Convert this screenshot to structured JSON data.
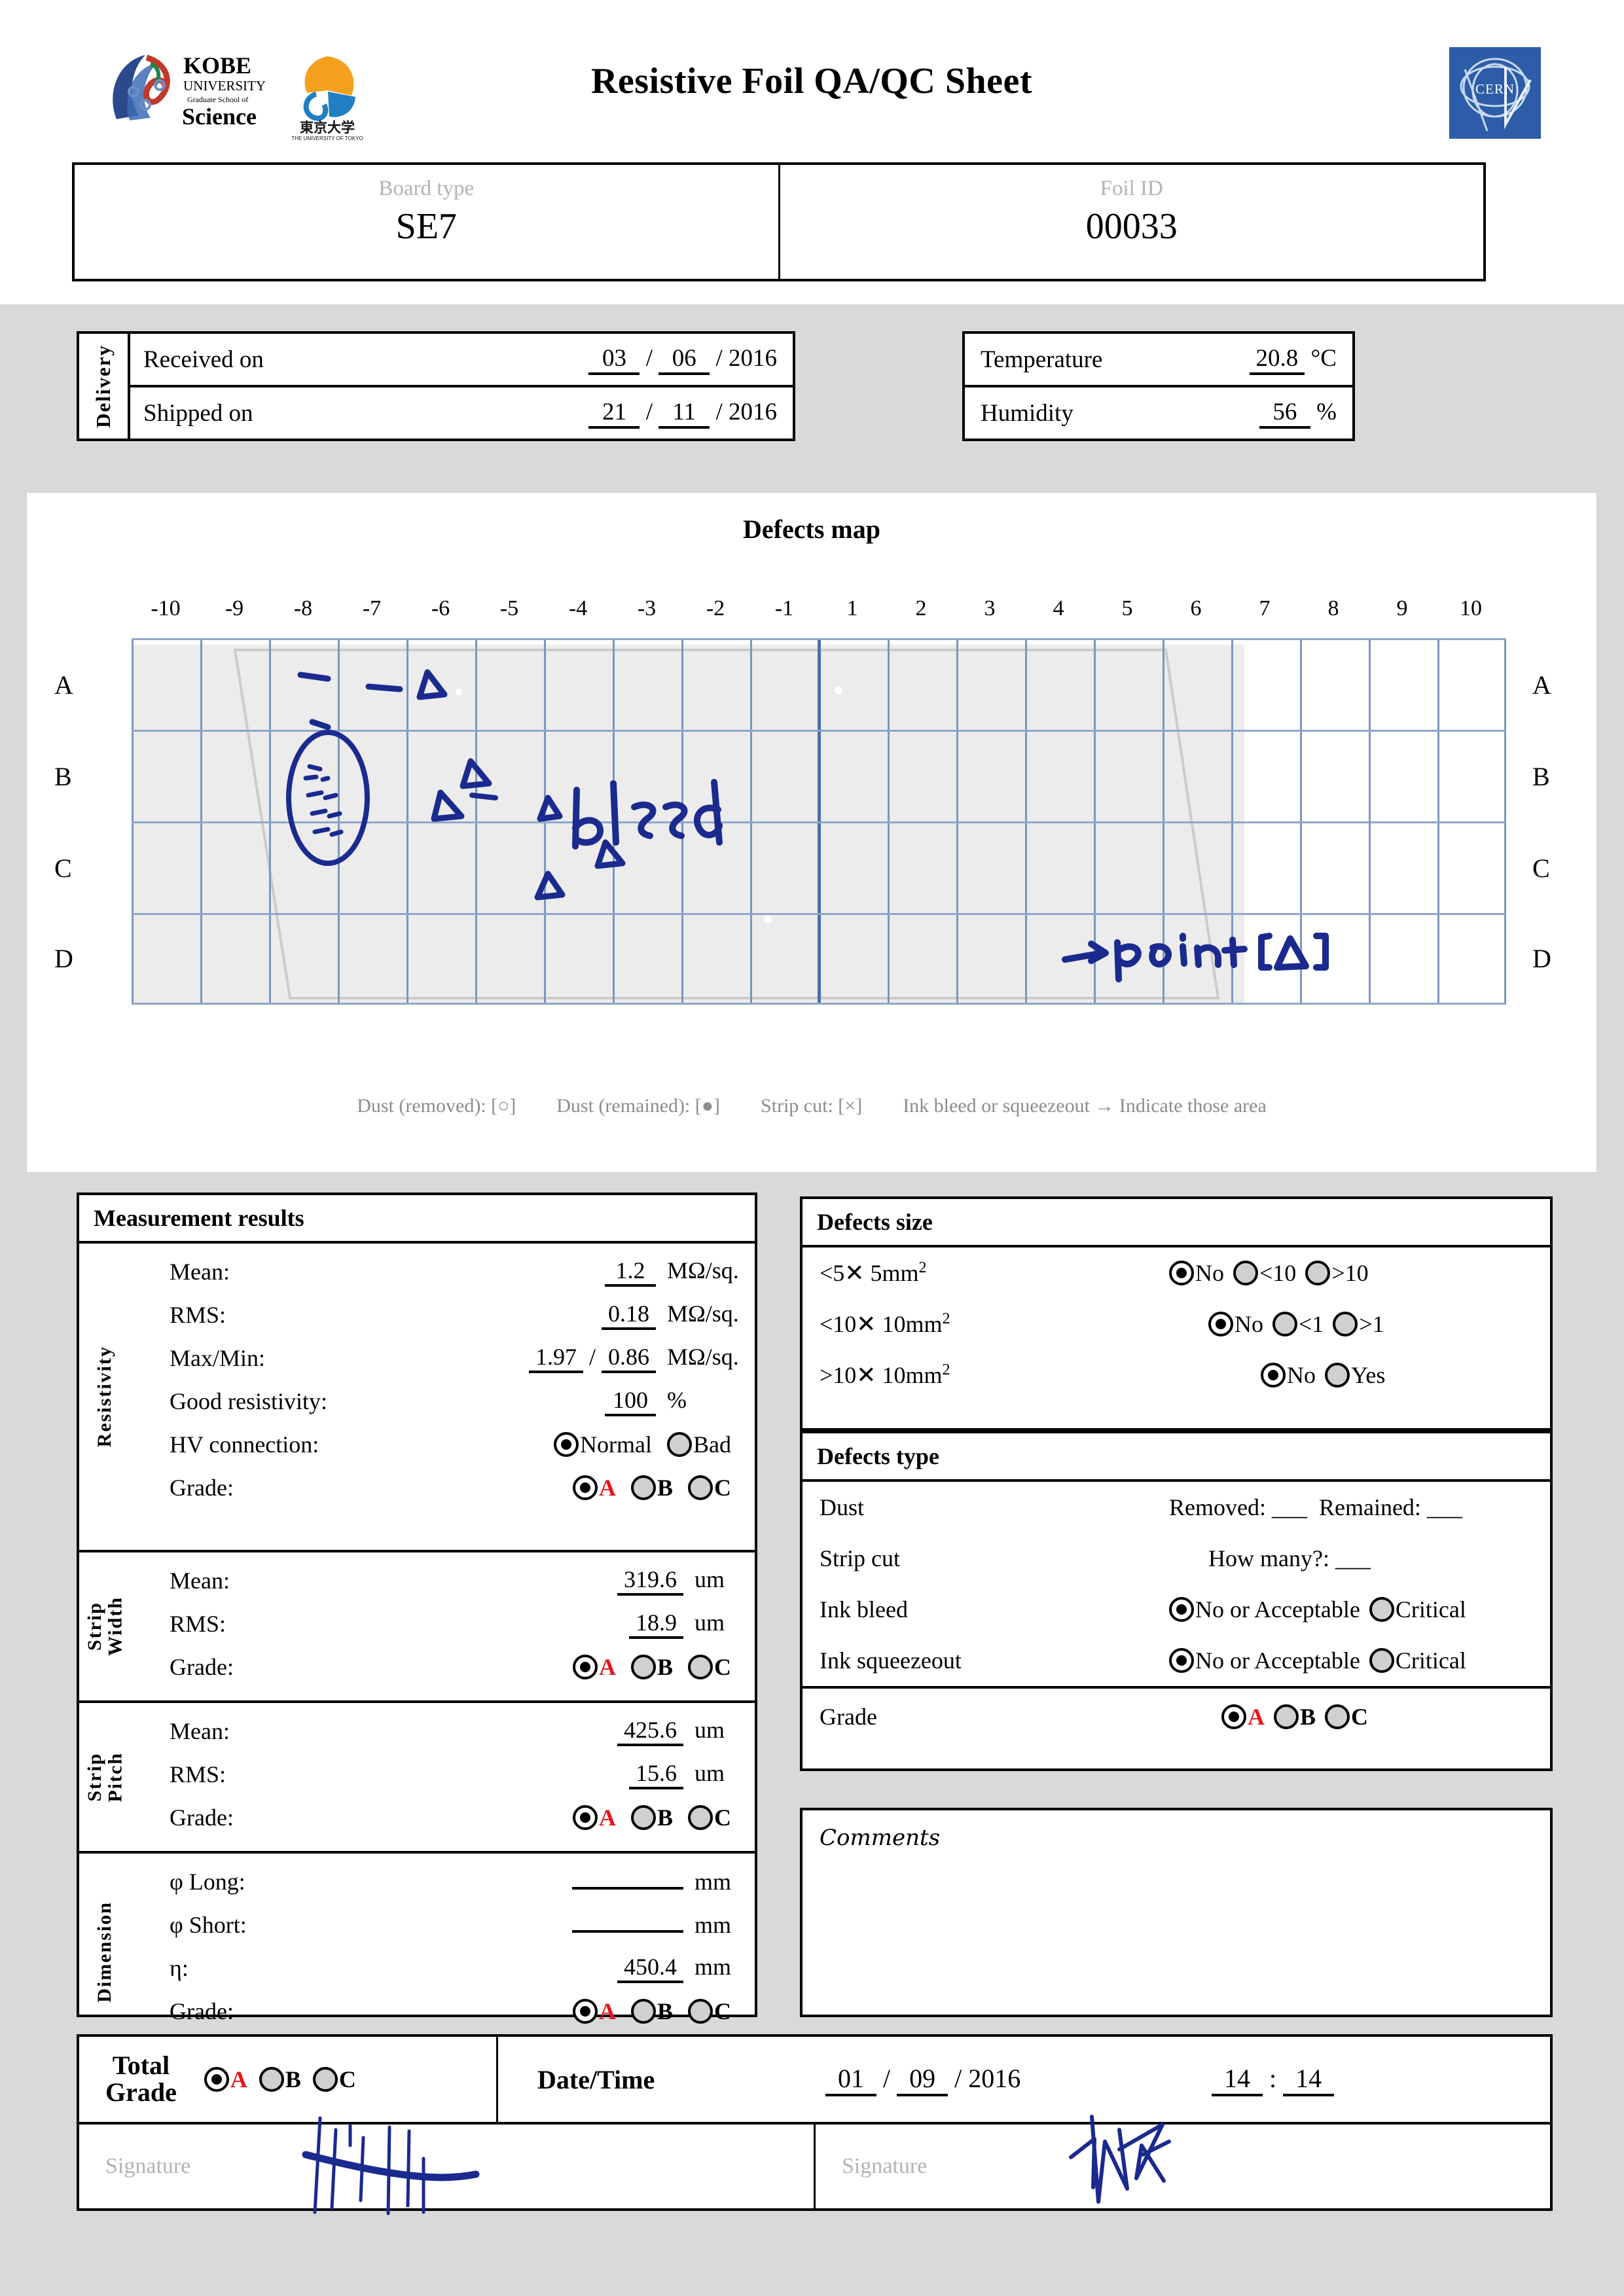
{
  "header": {
    "title": "Resistive Foil QA/QC Sheet",
    "logo_kobe_line1": "KOBE",
    "logo_kobe_line2": "UNIVERSITY",
    "logo_kobe_line3": "Graduate School of",
    "logo_kobe_line4": "Science",
    "logo_todai": "東京大学",
    "logo_todai_sub": "THE UNIVERSITY OF TOKYO",
    "logo_cern": "CERN",
    "board_type_caption": "Board type",
    "board_type_value": "SE7",
    "foil_id_caption": "Foil ID",
    "foil_id_value": "00033"
  },
  "delivery": {
    "section_label": "Delivery",
    "received_label": "Received on",
    "received_day": "03",
    "received_month": "06",
    "received_year": "2016",
    "shipped_label": "Shipped on",
    "shipped_day": "21",
    "shipped_month": "11",
    "shipped_year": "2016",
    "sep": "/"
  },
  "environment": {
    "temperature_label": "Temperature",
    "temperature_value": "20.8",
    "temperature_unit": "°C",
    "humidity_label": "Humidity",
    "humidity_value": "56",
    "humidity_unit": "%"
  },
  "defects_map": {
    "title": "Defects map",
    "columns": [
      "-10",
      "-9",
      "-8",
      "-7",
      "-6",
      "-5",
      "-4",
      "-3",
      "-2",
      "-1",
      "1",
      "2",
      "3",
      "4",
      "5",
      "6",
      "7",
      "8",
      "9",
      "10"
    ],
    "rows": [
      "A",
      "B",
      "C",
      "D"
    ],
    "legend": [
      "Dust (removed): [○]",
      "Dust (remained): [●]",
      "Strip cut: [×]",
      "Ink bleed or squeezeout → Indicate those area"
    ],
    "annotations": {
      "bleed": "bleed",
      "point": "→ point [Δ]"
    }
  },
  "measurement": {
    "title": "Measurement results",
    "resistivity": {
      "label": "Resistivity",
      "mean_label": "Mean:",
      "mean_value": "1.2",
      "mean_unit": "MΩ/sq.",
      "rms_label": "RMS:",
      "rms_value": "0.18",
      "rms_unit": "MΩ/sq.",
      "maxmin_label": "Max/Min:",
      "max_value": "1.97",
      "min_value": "0.86",
      "maxmin_unit": "MΩ/sq.",
      "good_label": "Good resistivity:",
      "good_value": "100",
      "good_unit": "%",
      "hv_label": "HV connection:",
      "hv_opt1": "Normal",
      "hv_opt2": "Bad",
      "hv_selected": "Normal",
      "grade_label": "Grade:",
      "grade_options": [
        "A",
        "B",
        "C"
      ],
      "grade_selected": "A"
    },
    "strip_width": {
      "label_line1": "Strip",
      "label_line2": "Width",
      "mean_label": "Mean:",
      "mean_value": "319.6",
      "mean_unit": "um",
      "rms_label": "RMS:",
      "rms_value": "18.9",
      "rms_unit": "um",
      "grade_label": "Grade:",
      "grade_options": [
        "A",
        "B",
        "C"
      ],
      "grade_selected": "A"
    },
    "strip_pitch": {
      "label_line1": "Strip",
      "label_line2": "Pitch",
      "mean_label": "Mean:",
      "mean_value": "425.6",
      "mean_unit": "um",
      "rms_label": "RMS:",
      "rms_value": "15.6",
      "rms_unit": "um",
      "grade_label": "Grade:",
      "grade_options": [
        "A",
        "B",
        "C"
      ],
      "grade_selected": "A"
    },
    "dimension": {
      "label": "Dimension",
      "long_label": "φ Long:",
      "long_value": "",
      "long_unit": "mm",
      "short_label": "φ Short:",
      "short_value": "",
      "short_unit": "mm",
      "eta_label": "η:",
      "eta_value": "450.4",
      "eta_unit": "mm",
      "grade_label": "Grade:",
      "grade_options": [
        "A",
        "B",
        "C"
      ],
      "grade_selected": "A"
    }
  },
  "defects_size": {
    "title": "Defects size",
    "rows": [
      {
        "label": "<5✕ 5mm",
        "sup": "2",
        "options": [
          "No",
          "<10",
          ">10"
        ],
        "selected": "No"
      },
      {
        "label": "<10✕ 10mm",
        "sup": "2",
        "options": [
          "No",
          "<1",
          ">1"
        ],
        "selected": "No"
      },
      {
        "label": ">10✕ 10mm",
        "sup": "2",
        "options": [
          "No",
          "Yes"
        ],
        "selected": "No"
      }
    ]
  },
  "defects_type": {
    "title": "Defects type",
    "dust_label": "Dust",
    "dust_removed_label": "Removed:",
    "dust_removed_value": "___",
    "dust_remained_label": "Remained:",
    "dust_remained_value": "___",
    "strip_cut_label": "Strip cut",
    "strip_cut_question": "How many?:",
    "strip_cut_value": "___",
    "ink_bleed_label": "Ink bleed",
    "ink_bleed_opt1": "No or Acceptable",
    "ink_bleed_opt2": "Critical",
    "ink_bleed_selected": "No or Acceptable",
    "ink_squeeze_label": "Ink squeezeout",
    "ink_squeeze_opt1": "No or Acceptable",
    "ink_squeeze_opt2": "Critical",
    "ink_squeeze_selected": "No or Acceptable",
    "grade_label": "Grade",
    "grade_options": [
      "A",
      "B",
      "C"
    ],
    "grade_selected": "A"
  },
  "comments": {
    "label": "Comments",
    "text": ""
  },
  "footer": {
    "total_grade_line1": "Total",
    "total_grade_line2": "Grade",
    "total_grade_options": [
      "A",
      "B",
      "C"
    ],
    "total_grade_selected": "A",
    "datetime_label": "Date/Time",
    "date_day": "01",
    "date_month": "09",
    "date_year": "2016",
    "time_hour": "14",
    "time_minute": "14",
    "date_sep": "/",
    "time_sep": ":",
    "signature_label_left": "Signature",
    "signature_label_right": "Signature"
  },
  "colors": {
    "grade_accent": "#e8141b",
    "ink_blue": "#1b2a8f",
    "grid_blue": "#7b96bf",
    "cern_blue": "#2d5ca8",
    "page_grey": "#d9d9d9"
  }
}
